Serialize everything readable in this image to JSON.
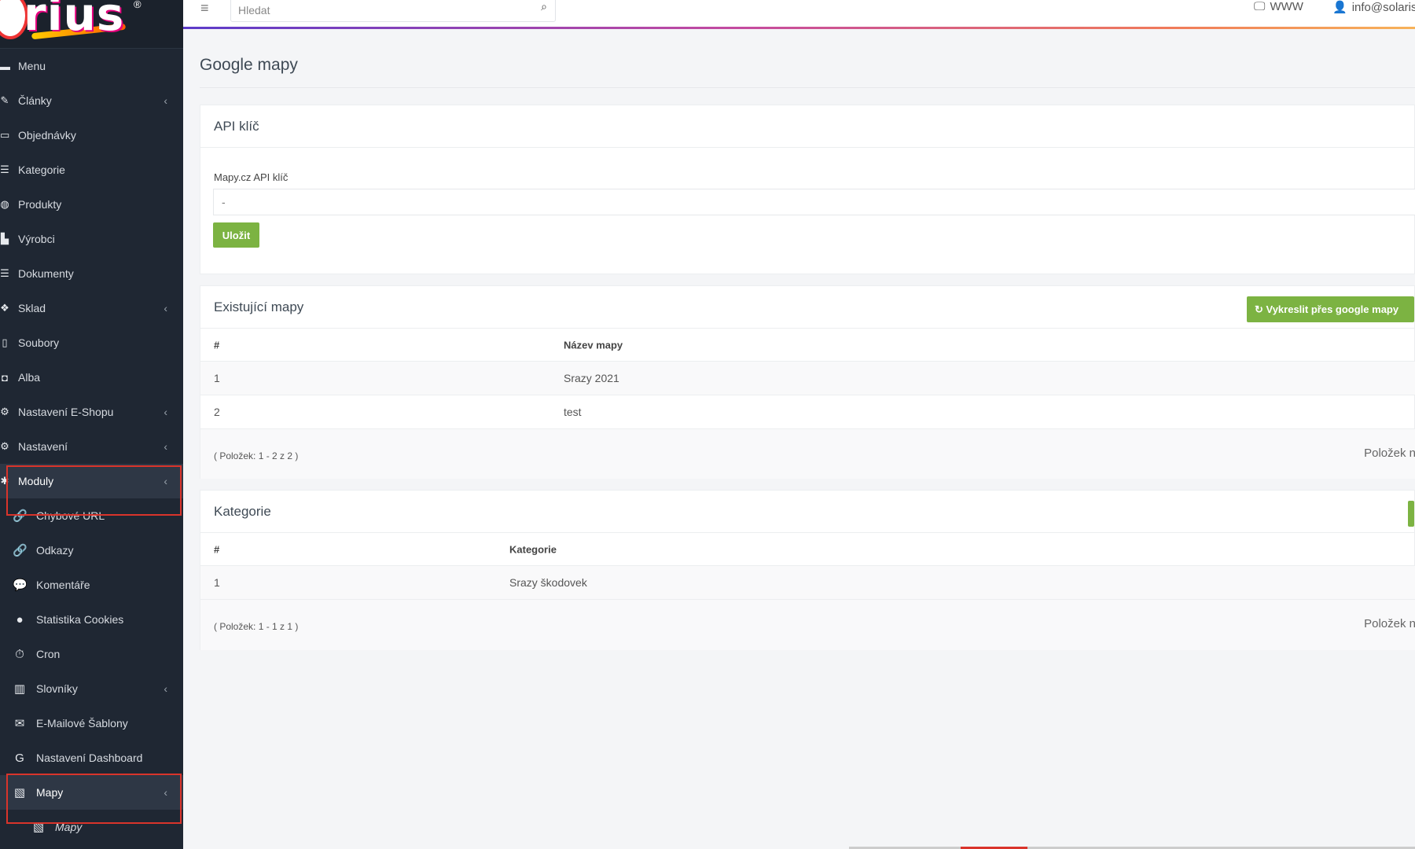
{
  "sidebar": {
    "logo_text": "rius",
    "items": [
      {
        "label": "Menu",
        "icon": "folder-icon",
        "glyph": "▬"
      },
      {
        "label": "Články",
        "icon": "pencil-icon",
        "glyph": "✎",
        "chevron": "‹"
      },
      {
        "label": "Objednávky",
        "icon": "cart-icon",
        "glyph": "▭"
      },
      {
        "label": "Kategorie",
        "icon": "list-icon",
        "glyph": "☰"
      },
      {
        "label": "Produkty",
        "icon": "dribbble-icon",
        "glyph": "◍"
      },
      {
        "label": "Výrobci",
        "icon": "industry-icon",
        "glyph": "▙"
      },
      {
        "label": "Dokumenty",
        "icon": "list-icon",
        "glyph": "☰"
      },
      {
        "label": "Sklad",
        "icon": "dropbox-icon",
        "glyph": "❖",
        "chevron": "‹"
      },
      {
        "label": "Soubory",
        "icon": "file-icon",
        "glyph": "▯"
      },
      {
        "label": "Alba",
        "icon": "camera-icon",
        "glyph": "◘"
      },
      {
        "label": "Nastavení E-Shopu",
        "icon": "gear-icon",
        "glyph": "⚙",
        "chevron": "‹"
      },
      {
        "label": "Nastavení",
        "icon": "gear-icon",
        "glyph": "⚙",
        "chevron": "‹"
      },
      {
        "label": "Moduly",
        "icon": "puzzle-icon",
        "glyph": "✱",
        "chevron": "‹"
      },
      {
        "label": "Chybové URL",
        "icon": "link-icon",
        "glyph": "🔗"
      },
      {
        "label": "Odkazy",
        "icon": "link-icon",
        "glyph": "🔗"
      },
      {
        "label": "Komentáře",
        "icon": "comments-icon",
        "glyph": "💬"
      },
      {
        "label": "Statistika Cookies",
        "icon": "cookie-icon",
        "glyph": "●"
      },
      {
        "label": "Cron",
        "icon": "stopwatch-icon",
        "glyph": "⏱"
      },
      {
        "label": "Slovníky",
        "icon": "books-icon",
        "glyph": "▥",
        "chevron": "‹"
      },
      {
        "label": "E-Mailové Šablony",
        "icon": "envelope-icon",
        "glyph": "✉"
      },
      {
        "label": "Nastavení Dashboard",
        "icon": "google-icon",
        "glyph": "G"
      },
      {
        "label": "Mapy",
        "icon": "map-icon",
        "glyph": "▧",
        "chevron": "‹"
      },
      {
        "label": "Mapy",
        "icon": "map-icon",
        "glyph": "▧"
      }
    ]
  },
  "topbar": {
    "search_placeholder": "Hledat",
    "www_label": "WWW",
    "user_label": "info@solaris"
  },
  "page": {
    "title": "Google mapy"
  },
  "api_card": {
    "title": "API klíč",
    "field_label": "Mapy.cz API klíč",
    "field_value": "-",
    "save_label": "Uložit"
  },
  "maps_card": {
    "title": "Existující mapy",
    "draw_button": "Vykreslit přes google mapy",
    "columns": [
      "#",
      "Název mapy"
    ],
    "rows": [
      {
        "id": "1",
        "name": "Srazy 2021"
      },
      {
        "id": "2",
        "name": "test"
      }
    ],
    "footer_count": "( Položek: 1 - 2 z 2 )",
    "footer_right": "Položek n"
  },
  "categories_card": {
    "title": "Kategorie",
    "columns": [
      "#",
      "Kategorie"
    ],
    "rows": [
      {
        "id": "1",
        "name": "Srazy škodovek"
      }
    ],
    "footer_count": "( Položek: 1 - 1 z 1 )",
    "footer_right": "Položek n"
  },
  "colors": {
    "sidebar_bg": "#1f2733",
    "accent_green": "#7cb342",
    "highlight_red": "#d9342b"
  }
}
